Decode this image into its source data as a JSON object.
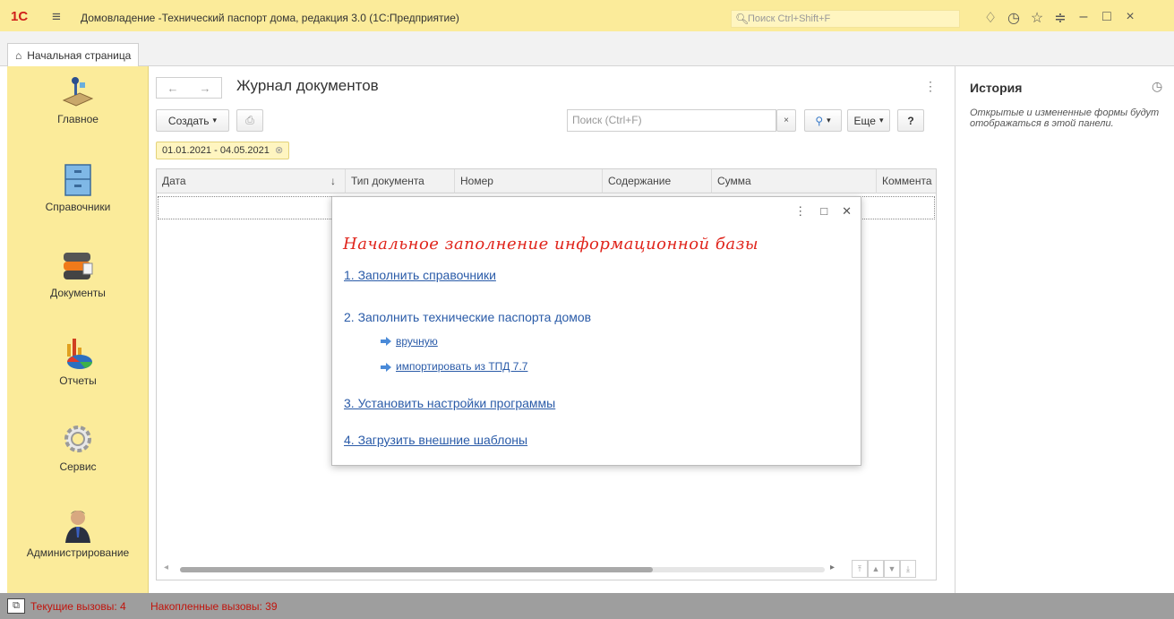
{
  "window": {
    "title": "Домовладение -Технический паспорт дома, редакция 3.0  (1С:Предприятие)",
    "search_placeholder": "Поиск Ctrl+Shift+F",
    "logo": "1C"
  },
  "tabs": [
    {
      "label": "Начальная страница"
    }
  ],
  "sidebar": {
    "items": [
      {
        "label": "Главное",
        "icon": "desk-lamp-icon"
      },
      {
        "label": "Справочники",
        "icon": "cabinet-icon"
      },
      {
        "label": "Документы",
        "icon": "documents-icon"
      },
      {
        "label": "Отчеты",
        "icon": "chart-icon"
      },
      {
        "label": "Сервис",
        "icon": "gear-icon"
      },
      {
        "label": "Администрирование",
        "icon": "admin-icon"
      }
    ]
  },
  "main": {
    "title": "Журнал документов",
    "create_label": "Создать",
    "search_placeholder": "Поиск (Ctrl+F)",
    "more_label": "Еще",
    "help_label": "?",
    "period": "01.01.2021 - 04.05.2021",
    "columns": [
      "Дата",
      "Тип документа",
      "Номер",
      "Содержание",
      "Сумма",
      "Коммента"
    ]
  },
  "popup": {
    "title": "Начальное заполнение информационной базы",
    "link1": "1. Заполнить справочники",
    "heading2": "2. Заполнить технические  паспорта  домов",
    "sub_manual": "вручную",
    "sub_import": "импортировать  из ТПД 7.7",
    "link3": "3. Установить настройки программы",
    "link4": "4. Загрузить внешние шаблоны"
  },
  "history": {
    "title": "История",
    "description": "Открытые и измененные формы будут отображаться в этой панели."
  },
  "status": {
    "current_calls": "Текущие вызовы: 4",
    "accumulated_calls": "Накопленные вызовы: 39"
  },
  "colors": {
    "accent_yellow": "#fbeb9a",
    "link_blue": "#2a5ba8",
    "title_red": "#e0251c",
    "status_gray": "#9e9e9e"
  }
}
